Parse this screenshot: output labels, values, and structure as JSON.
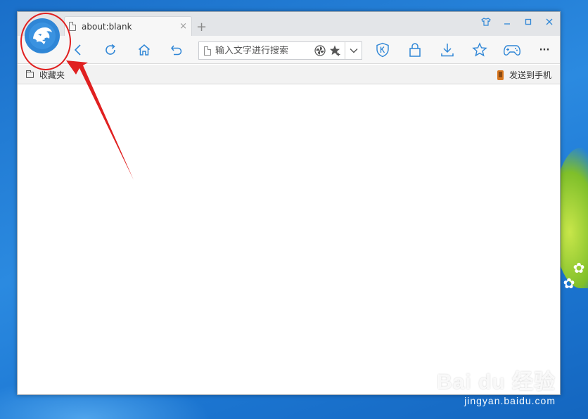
{
  "browser": {
    "tab": {
      "title": "about:blank",
      "close_glyph": "×"
    },
    "new_tab_glyph": "+",
    "window_controls": [
      {
        "name": "skin-button",
        "icon": "shirt-icon"
      },
      {
        "name": "minimize-button",
        "icon": "minimize-icon"
      },
      {
        "name": "maximize-button",
        "icon": "maximize-icon"
      },
      {
        "name": "close-button",
        "icon": "close-icon"
      }
    ],
    "toolbar": {
      "buttons": [
        "back-icon",
        "refresh-icon",
        "home-icon",
        "undo-icon",
        "shield-k-icon",
        "lock-icon",
        "download-icon",
        "star-icon",
        "gamepad-icon",
        "more-icon"
      ],
      "more_glyph": "···"
    },
    "address_bar": {
      "placeholder": "输入文字进行搜索",
      "value": ""
    },
    "favorites_bar": {
      "left_label": "收藏夹",
      "right_label": "发送到手机"
    }
  },
  "watermark": {
    "logo_text": "Bai du 经验",
    "url": "jingyan.baidu.com"
  },
  "colors": {
    "accent": "#2f86d6",
    "annotation": "#e02020",
    "desktop": "#1d78d4"
  }
}
